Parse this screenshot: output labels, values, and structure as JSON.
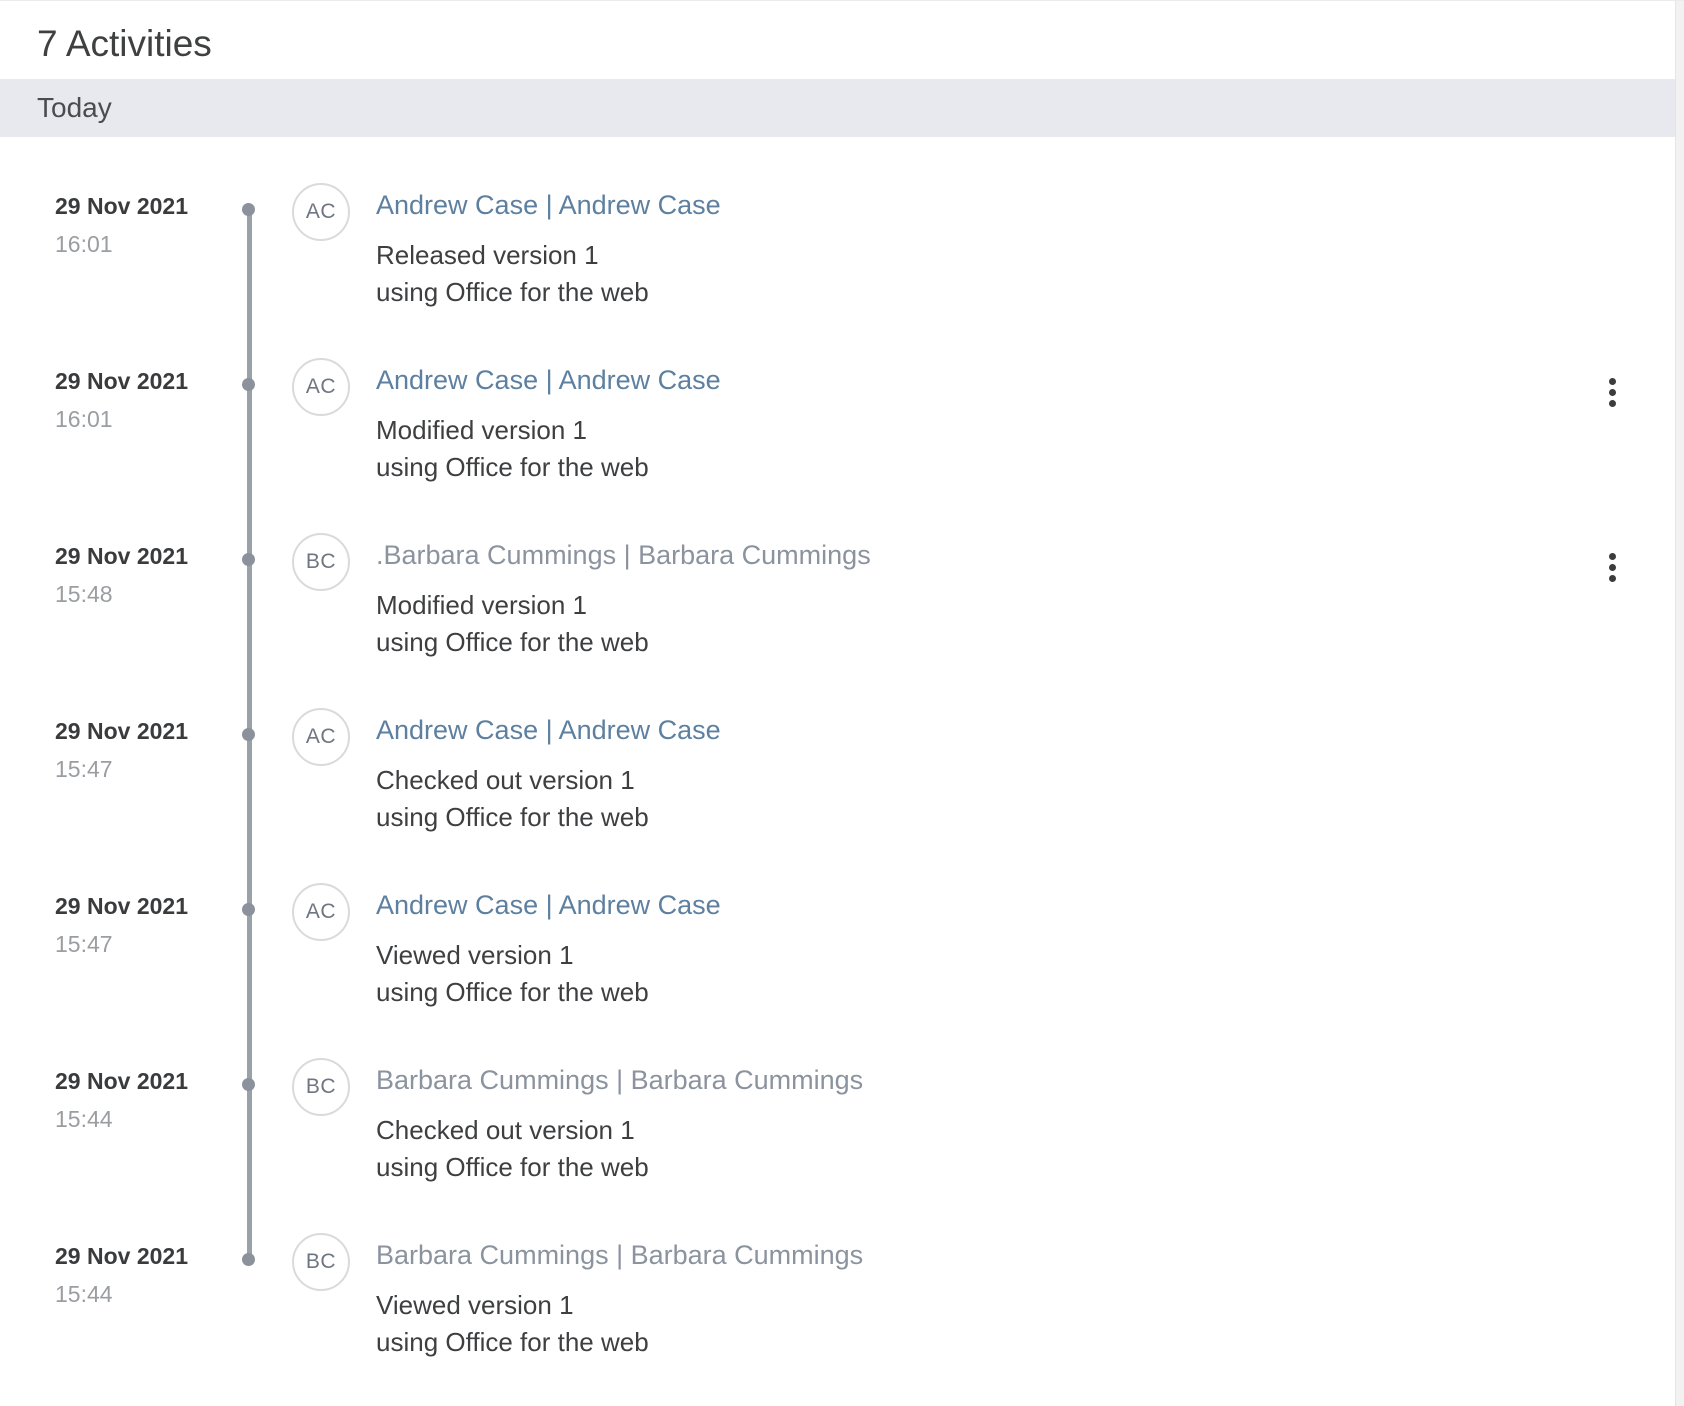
{
  "panel": {
    "title": "7 Activities",
    "group_label": "Today"
  },
  "colors": {
    "andrew_name": "#5d80a0",
    "barbara_name": "#8b939e",
    "action_text": "#3e3f41",
    "date_text": "#3a3b3d",
    "time_text": "#9a9da1",
    "today_bar_bg": "#e7e9ef",
    "timeline_gray": "#99a1a9",
    "avatar_border": "#d8dadc"
  },
  "entries": [
    {
      "date": "29 Nov 2021",
      "time": "16:01",
      "initials": "AC",
      "name": "Andrew Case | Andrew Case",
      "name_color": "#5d80a0",
      "action": "Released version 1",
      "via": "using Office for the web",
      "has_menu": false
    },
    {
      "date": "29 Nov 2021",
      "time": "16:01",
      "initials": "AC",
      "name": "Andrew Case | Andrew Case",
      "name_color": "#5d80a0",
      "action": "Modified version 1",
      "via": "using Office for the web",
      "has_menu": true
    },
    {
      "date": "29 Nov 2021",
      "time": "15:48",
      "initials": "BC",
      "name": ".Barbara Cummings | Barbara Cummings",
      "name_color": "#8b939e",
      "action": "Modified version 1",
      "via": "using Office for the web",
      "has_menu": true
    },
    {
      "date": "29 Nov 2021",
      "time": "15:47",
      "initials": "AC",
      "name": "Andrew Case | Andrew Case",
      "name_color": "#5d80a0",
      "action": "Checked out version 1",
      "via": "using Office for the web",
      "has_menu": false
    },
    {
      "date": "29 Nov 2021",
      "time": "15:47",
      "initials": "AC",
      "name": "Andrew Case | Andrew Case",
      "name_color": "#5d80a0",
      "action": "Viewed version 1",
      "via": "using Office for the web",
      "has_menu": false
    },
    {
      "date": "29 Nov 2021",
      "time": "15:44",
      "initials": "BC",
      "name": "Barbara Cummings | Barbara Cummings",
      "name_color": "#8b939e",
      "action": "Checked out version 1",
      "via": "using Office for the web",
      "has_menu": false
    },
    {
      "date": "29 Nov 2021",
      "time": "15:44",
      "initials": "BC",
      "name": "Barbara Cummings | Barbara Cummings",
      "name_color": "#8b939e",
      "action": "Viewed version 1",
      "via": "using Office for the web",
      "has_menu": false
    }
  ]
}
